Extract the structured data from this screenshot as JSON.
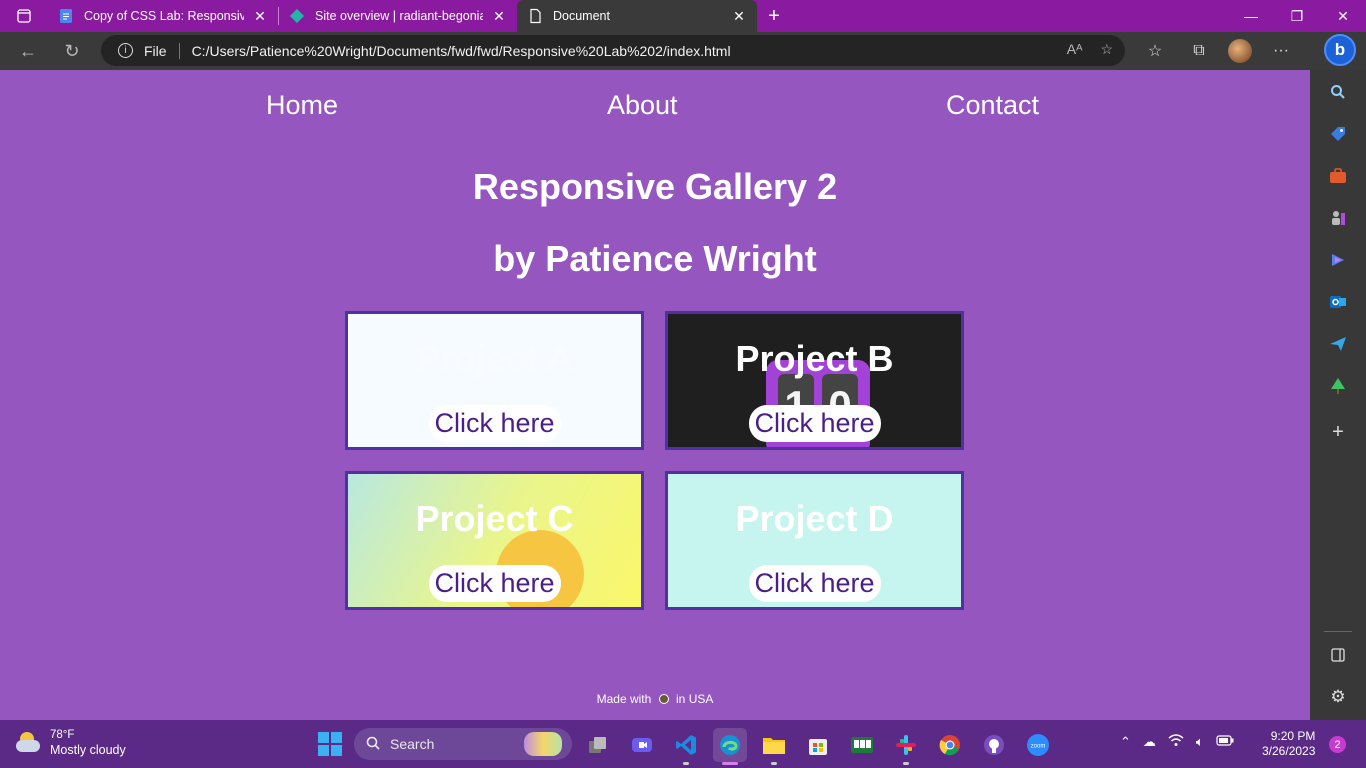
{
  "browser": {
    "tabs": [
      {
        "title": "Copy of CSS Lab: Responsive Gal",
        "favicon": "google-docs-icon"
      },
      {
        "title": "Site overview | radiant-begonia-c",
        "favicon": "netlify-icon"
      },
      {
        "title": "Document",
        "favicon": "document-icon",
        "active": true
      }
    ],
    "address": {
      "scheme_label": "File",
      "url": "C:/Users/Patience%20Wright/Documents/fwd/fwd/Responsive%20Lab%202/index.html"
    }
  },
  "page": {
    "nav": [
      "Home",
      "About",
      "Contact"
    ],
    "title": "Responsive Gallery 2",
    "subtitle": "by Patience Wright",
    "cards": [
      {
        "title": "Project A",
        "button": "Click here"
      },
      {
        "title": "Project B",
        "button": "Click here"
      },
      {
        "title": "Project C",
        "button": "Click here"
      },
      {
        "title": "Project D",
        "button": "Click here"
      }
    ],
    "counter_digits": [
      "1",
      "0"
    ],
    "footer": {
      "prefix": "Made with",
      "suffix": "in USA"
    }
  },
  "taskbar": {
    "weather": {
      "temp": "78°F",
      "desc": "Mostly cloudy"
    },
    "search_label": "Search",
    "time": "9:20 PM",
    "date": "3/26/2023",
    "notifications": "2"
  },
  "colors": {
    "page_bg": "#9556bf",
    "titlebar_bg": "#8a1aa0",
    "card_border": "#4e32a0",
    "button_text": "#4b1f87"
  }
}
